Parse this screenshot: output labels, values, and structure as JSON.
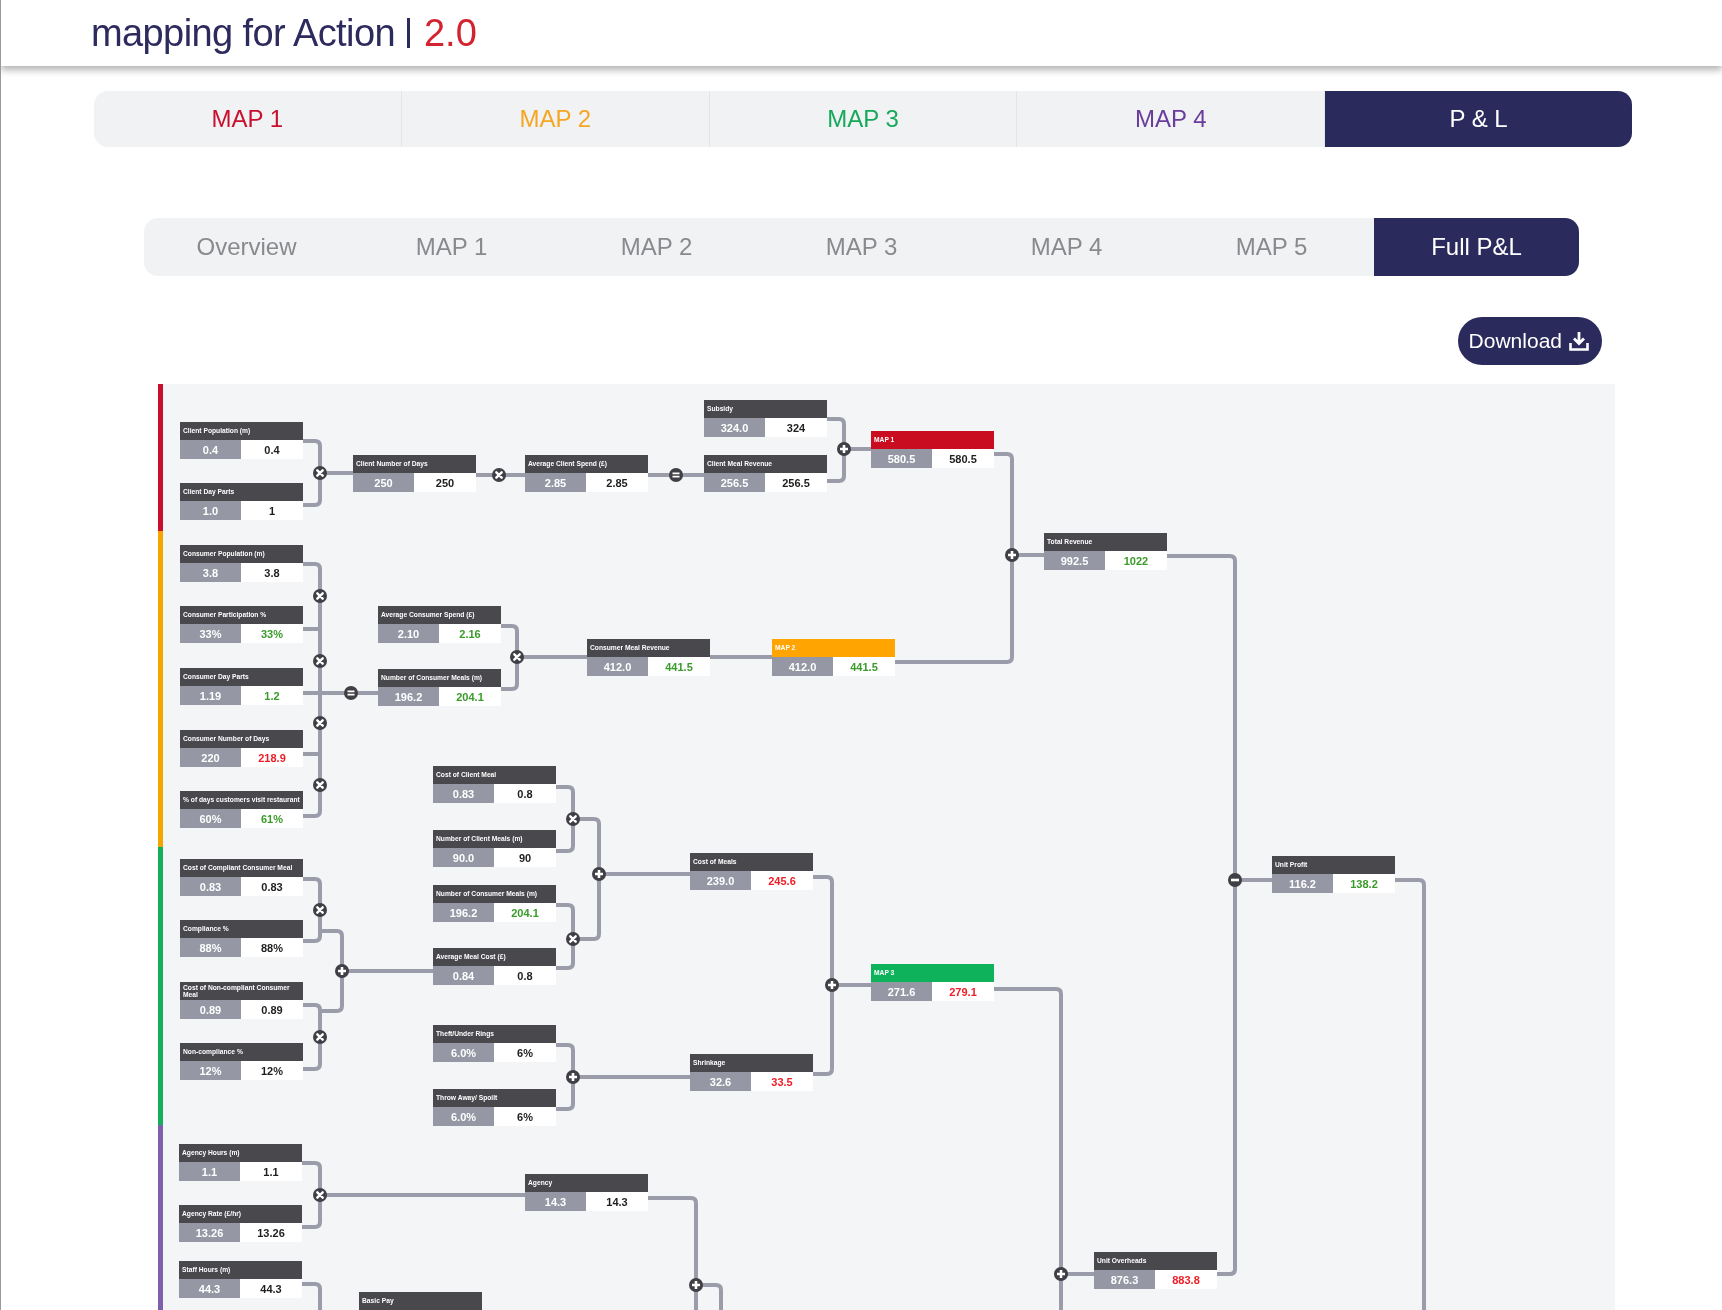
{
  "header": {
    "logo": {
      "name": "mapping for Action",
      "version": "2.0"
    }
  },
  "map_tabs": [
    {
      "label": "MAP 1",
      "color": "#c8102e",
      "selected": false
    },
    {
      "label": "MAP 2",
      "color": "#f5a623",
      "selected": false
    },
    {
      "label": "MAP 3",
      "color": "#17a95b",
      "selected": false
    },
    {
      "label": "MAP 4",
      "color": "#6a3d9a",
      "selected": false
    },
    {
      "label": "P & L",
      "color": "#2b2a5c",
      "selected": true
    }
  ],
  "sub_tabs": [
    {
      "label": "Overview",
      "selected": false
    },
    {
      "label": "MAP 1",
      "selected": false
    },
    {
      "label": "MAP 2",
      "selected": false
    },
    {
      "label": "MAP 3",
      "selected": false
    },
    {
      "label": "MAP 4",
      "selected": false
    },
    {
      "label": "MAP 5",
      "selected": false
    },
    {
      "label": "Full P&L",
      "selected": true
    }
  ],
  "download_button": {
    "label": "Download"
  },
  "diagram": {
    "groups": [
      {
        "color": "#c8102e"
      },
      {
        "color": "#f5a500"
      },
      {
        "color": "#12b05c"
      },
      {
        "color": "#7e5fad"
      }
    ],
    "nodes": [
      {
        "label": "Client Population (m)",
        "baseline": "0.4",
        "current": "0.4",
        "better": false,
        "worse": false,
        "color": "#48484d"
      },
      {
        "label": "Client Day Parts",
        "baseline": "1.0",
        "current": "1",
        "better": false,
        "worse": false,
        "color": "#48484d"
      },
      {
        "label": "Client Number of Days",
        "baseline": "250",
        "current": "250",
        "better": false,
        "worse": false,
        "color": "#48484d"
      },
      {
        "label": "Average Client Spend (£)",
        "baseline": "2.85",
        "current": "2.85",
        "better": false,
        "worse": false,
        "color": "#48484d"
      },
      {
        "label": "Subsidy",
        "baseline": "324.0",
        "current": "324",
        "better": false,
        "worse": false,
        "color": "#48484d"
      },
      {
        "label": "Client Meal Revenue",
        "baseline": "256.5",
        "current": "256.5",
        "better": false,
        "worse": false,
        "color": "#48484d"
      },
      {
        "label": "MAP 1",
        "baseline": "580.5",
        "current": "580.5",
        "better": false,
        "worse": false,
        "color": "#c90c1f"
      },
      {
        "label": "Consumer Population (m)",
        "baseline": "3.8",
        "current": "3.8",
        "better": false,
        "worse": false,
        "color": "#48484d"
      },
      {
        "label": "Consumer Participation %",
        "baseline": "33%",
        "current": "33%",
        "better": true,
        "worse": false,
        "color": "#48484d"
      },
      {
        "label": "Consumer Day Parts",
        "baseline": "1.19",
        "current": "1.2",
        "better": true,
        "worse": false,
        "color": "#48484d"
      },
      {
        "label": "Consumer Number of Days",
        "baseline": "220",
        "current": "218.9",
        "better": false,
        "worse": true,
        "color": "#48484d"
      },
      {
        "label": "% of days customers visit restaurant",
        "baseline": "60%",
        "current": "61%",
        "better": true,
        "worse": false,
        "color": "#48484d"
      },
      {
        "label": "Average Consumer Spend (£)",
        "baseline": "2.10",
        "current": "2.16",
        "better": true,
        "worse": false,
        "color": "#48484d"
      },
      {
        "label": "Number of Consumer Meals (m)",
        "baseline": "196.2",
        "current": "204.1",
        "better": true,
        "worse": false,
        "color": "#48484d"
      },
      {
        "label": "Consumer Meal Revenue",
        "baseline": "412.0",
        "current": "441.5",
        "better": true,
        "worse": false,
        "color": "#48484d"
      },
      {
        "label": "MAP 2",
        "baseline": "412.0",
        "current": "441.5",
        "better": true,
        "worse": false,
        "color": "#ffa400"
      },
      {
        "label": "Total Revenue",
        "baseline": "992.5",
        "current": "1022",
        "better": true,
        "worse": false,
        "color": "#48484d"
      },
      {
        "label": "Cost of Client Meal",
        "baseline": "0.83",
        "current": "0.8",
        "better": false,
        "worse": false,
        "color": "#48484d"
      },
      {
        "label": "Number of Client Meals (m)",
        "baseline": "90.0",
        "current": "90",
        "better": false,
        "worse": false,
        "color": "#48484d"
      },
      {
        "label": "Number of Consumer Meals (m)",
        "baseline": "196.2",
        "current": "204.1",
        "better": true,
        "worse": false,
        "color": "#48484d"
      },
      {
        "label": "Average Meal Cost (£)",
        "baseline": "0.84",
        "current": "0.8",
        "better": false,
        "worse": false,
        "color": "#48484d"
      },
      {
        "label": "Cost of Compliant Consumer Meal",
        "baseline": "0.83",
        "current": "0.83",
        "better": false,
        "worse": false,
        "color": "#48484d"
      },
      {
        "label": "Compliance %",
        "baseline": "88%",
        "current": "88%",
        "better": false,
        "worse": false,
        "color": "#48484d"
      },
      {
        "label": "Cost of Non-compliant Consumer Meal",
        "baseline": "0.89",
        "current": "0.89",
        "better": false,
        "worse": false,
        "color": "#48484d"
      },
      {
        "label": "Non-compliance %",
        "baseline": "12%",
        "current": "12%",
        "better": false,
        "worse": false,
        "color": "#48484d"
      },
      {
        "label": "Theft/Under Rings",
        "baseline": "6.0%",
        "current": "6%",
        "better": false,
        "worse": false,
        "color": "#48484d"
      },
      {
        "label": "Throw Away/ Spoilt",
        "baseline": "6.0%",
        "current": "6%",
        "better": false,
        "worse": false,
        "color": "#48484d"
      },
      {
        "label": "Cost of Meals",
        "baseline": "239.0",
        "current": "245.6",
        "better": false,
        "worse": true,
        "color": "#48484d"
      },
      {
        "label": "Shrinkage",
        "baseline": "32.6",
        "current": "33.5",
        "better": false,
        "worse": true,
        "color": "#48484d"
      },
      {
        "label": "MAP 3",
        "baseline": "271.6",
        "current": "279.1",
        "better": false,
        "worse": true,
        "color": "#0db25b"
      },
      {
        "label": "Unit Profit",
        "baseline": "116.2",
        "current": "138.2",
        "better": true,
        "worse": false,
        "color": "#48484d"
      },
      {
        "label": "Agency Hours (m)",
        "baseline": "1.1",
        "current": "1.1",
        "better": false,
        "worse": false,
        "color": "#48484d"
      },
      {
        "label": "Agency Rate (£/hr)",
        "baseline": "13.26",
        "current": "13.26",
        "better": false,
        "worse": false,
        "color": "#48484d"
      },
      {
        "label": "Staff Hours (m)",
        "baseline": "44.3",
        "current": "44.3",
        "better": false,
        "worse": false,
        "color": "#48484d"
      },
      {
        "label": "Agency",
        "baseline": "14.3",
        "current": "14.3",
        "better": false,
        "worse": false,
        "color": "#48484d"
      },
      {
        "label": "Unit Overheads",
        "baseline": "876.3",
        "current": "883.8",
        "better": false,
        "worse": true,
        "color": "#48484d"
      },
      {
        "label": "Basic Pay",
        "color": "#48484d"
      }
    ]
  }
}
